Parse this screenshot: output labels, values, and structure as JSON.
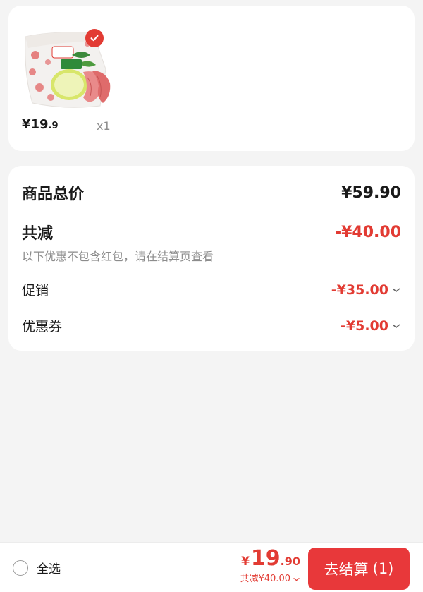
{
  "product": {
    "price_main": "¥19",
    "price_dec": ".9",
    "quantity": "x1",
    "selected": true,
    "image_icon": "pomelo-product-image",
    "package_text": "Dole"
  },
  "summary": {
    "total_label": "商品总价",
    "total_value": "¥59.90",
    "discount_label": "共减",
    "discount_value": "-¥40.00",
    "note": "以下优惠不包含红包，请在结算页查看",
    "promo_label": "促销",
    "promo_value": "-¥35.00",
    "coupon_label": "优惠券",
    "coupon_value": "-¥5.00"
  },
  "bottom_bar": {
    "select_all_label": "全选",
    "price_currency": "¥",
    "price_int": "19",
    "price_dec": ".90",
    "discount_text": "共减¥40.00",
    "checkout_label": "去结算",
    "checkout_count": "(1)"
  },
  "colors": {
    "accent": "#e23b33",
    "button": "#e8383a",
    "background": "#f4f4f4",
    "card": "#ffffff",
    "muted": "#8c8c8c"
  }
}
